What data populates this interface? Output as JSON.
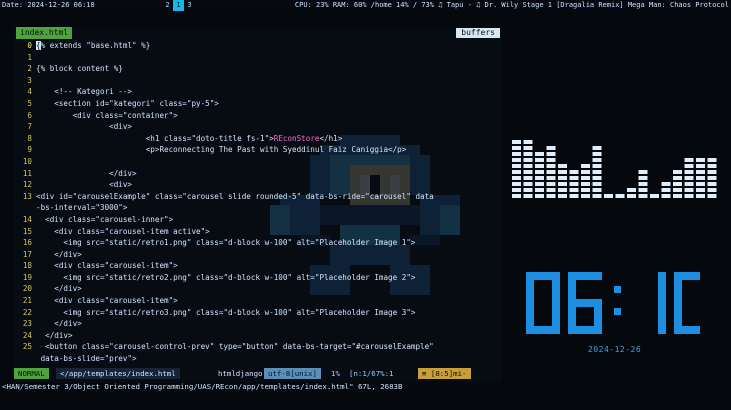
{
  "topbar": {
    "date_text": "Date: 2024-12-26 06:10",
    "workspaces": [
      "2",
      "1",
      "3"
    ],
    "active_workspace": "1",
    "stats_text": "CPU: 23%  RAM: 60%  /home 14% / 73%  ♫ Tapu - ♫ Dr. Wily Stage 1 [Dragalia Remix]  Mega Man: Chaos Protocol"
  },
  "editor": {
    "active_tab": "index.html",
    "buffers_label": "buffers",
    "lines": [
      {
        "num": "0",
        "pre": "",
        "cursor": "{",
        "text": "% extends \"base.html\" %}"
      },
      {
        "num": "1",
        "text": ""
      },
      {
        "num": "2",
        "text": "{% block content %}"
      },
      {
        "num": "3",
        "text": ""
      },
      {
        "num": "4",
        "text": "    <!-- Kategori -->",
        "cls": "c-cmt"
      },
      {
        "num": "5",
        "text": "    <section id=\"kategori\" class=\"py-5\">",
        "cls": "c-tag"
      },
      {
        "num": "6",
        "text": "        <div class=\"container\">",
        "cls": "c-tag"
      },
      {
        "num": "7",
        "text": "                <div>",
        "cls": "c-tag"
      },
      {
        "num": "8",
        "text": "                        <h1 class=\"doto-title fs-1\">",
        "cls": "c-tag",
        "pink": "REconStore",
        "tail": "</h1>"
      },
      {
        "num": "9",
        "text": "                        <p>Reconnecting The Past with Syeddinul Faiz Caniggia</p>",
        "cls": "c-tag"
      },
      {
        "num": "10",
        "text": ""
      },
      {
        "num": "11",
        "text": "                </div>",
        "cls": "c-tag"
      },
      {
        "num": "12",
        "text": "                <div>",
        "cls": "c-tag"
      },
      {
        "num": "13",
        "text": "<div id=\"carouselExample\" class=\"carousel slide rounded-5\" data-bs-ride=\"carousel\" data",
        "cls": "c-tag"
      },
      {
        "num": "",
        "text": "-bs-interval=\"3000\">",
        "cls": "c-tag"
      },
      {
        "num": "14",
        "text": "  <div class=\"carousel-inner\">",
        "cls": "c-tag"
      },
      {
        "num": "15",
        "text": "    <div class=\"carousel-item active\">",
        "cls": "c-tag"
      },
      {
        "num": "16",
        "text": "      <img src=\"static/retro1.png\" class=\"d-block w-100\" alt=\"Placeholder Image 1\">",
        "cls": "c-tag"
      },
      {
        "num": "17",
        "text": "    </div>",
        "cls": "c-tag"
      },
      {
        "num": "18",
        "text": "    <div class=\"carousel-item\">",
        "cls": "c-tag"
      },
      {
        "num": "19",
        "text": "      <img src=\"static/retro2.png\" class=\"d-block w-100\" alt=\"Placeholder Image 2\">",
        "cls": "c-tag"
      },
      {
        "num": "20",
        "text": "    </div>",
        "cls": "c-tag"
      },
      {
        "num": "21",
        "text": "    <div class=\"carousel-item\">",
        "cls": "c-tag"
      },
      {
        "num": "22",
        "text": "      <img src=\"static/retro3.png\" class=\"d-block w-100\" alt=\"Placeholder Image 3\">",
        "cls": "c-tag"
      },
      {
        "num": "23",
        "text": "    </div>",
        "cls": "c-tag"
      },
      {
        "num": "24",
        "text": "  </div>",
        "cls": "c-tag"
      },
      {
        "num": "25",
        "text": "  <button class=\"carousel-control-prev\" type=\"button\" data-bs-target=\"#carouselExample\"",
        "cls": "c-tag"
      },
      {
        "num": "",
        "text": " data-bs-slide=\"prev\">",
        "cls": "c-tag"
      }
    ]
  },
  "statusline": {
    "mode": "NORMAL",
    "file": "</app/templates/index.html",
    "filetype": "htmldjango",
    "encoding": "utf-8[unix]",
    "percent": "1%",
    "position": "[n:1/67%:1",
    "warnings": "≡ [8:5]mi-"
  },
  "cmdline": "<HAN/Semester 3/Object Oriented Programming/UAS/REcon/app/templates/index.html\" 67L, 2683B",
  "visualizer": {
    "color": "#dfeefa",
    "levels": [
      10,
      10,
      8,
      9,
      6,
      5,
      6,
      9,
      1,
      1,
      2,
      5,
      1,
      3,
      5,
      7,
      7,
      7
    ]
  },
  "clock": {
    "time": "06:10",
    "date": "2024-12-26",
    "color": "#1e8fe0"
  }
}
